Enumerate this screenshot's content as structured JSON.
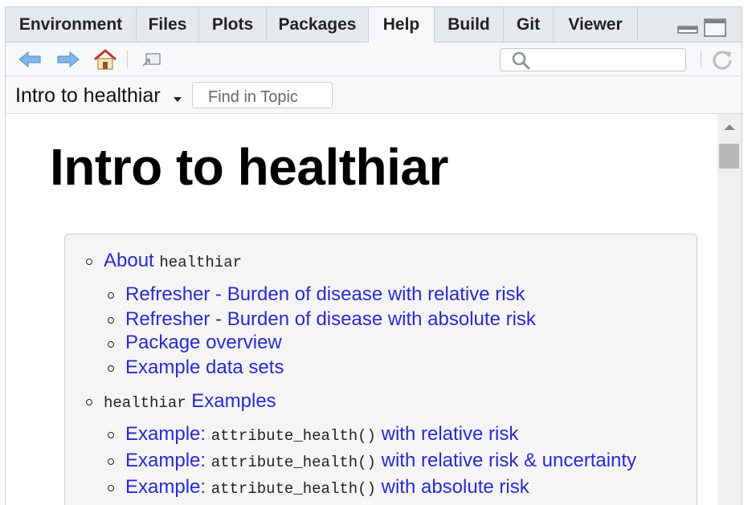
{
  "tabs": [
    {
      "label": "Environment"
    },
    {
      "label": "Files"
    },
    {
      "label": "Plots"
    },
    {
      "label": "Packages"
    },
    {
      "label": "Help"
    },
    {
      "label": "Build"
    },
    {
      "label": "Git"
    },
    {
      "label": "Viewer"
    }
  ],
  "active_tab": "Help",
  "toolbar": {
    "icons": [
      "back-arrow-icon",
      "forward-arrow-icon",
      "home-icon",
      "show-in-new-window-icon",
      "search-icon",
      "refresh-icon"
    ],
    "search_value": ""
  },
  "topic": {
    "title": "Intro to healthiar",
    "find_placeholder": "Find in Topic"
  },
  "doc": {
    "heading": "Intro to healthiar",
    "toc": [
      {
        "link": "About",
        "code": "healthiar"
      },
      {
        "link": "Refresher - Burden of disease with relative risk"
      },
      {
        "link": "Refresher - Burden of disease with absolute risk"
      },
      {
        "link": "Package overview"
      },
      {
        "link": "Example data sets"
      },
      {
        "code": "healthiar",
        "link": "Examples"
      },
      {
        "link": "Example:",
        "code": "attribute_health()",
        "link2": "with relative risk"
      },
      {
        "link": "Example:",
        "code": "attribute_health()",
        "link2": "with relative risk & uncertainty"
      },
      {
        "link": "Example:",
        "code": "attribute_health()",
        "link2": "with absolute risk"
      }
    ]
  },
  "colors": {
    "link": "#2a2ad0",
    "tab_bg": "#e6e9ec",
    "toolbar_bg": "#f7f8f9",
    "toc_bg": "#f5f5f5",
    "icon_blue": "#5aa0e0",
    "home_red": "#c0392b"
  }
}
